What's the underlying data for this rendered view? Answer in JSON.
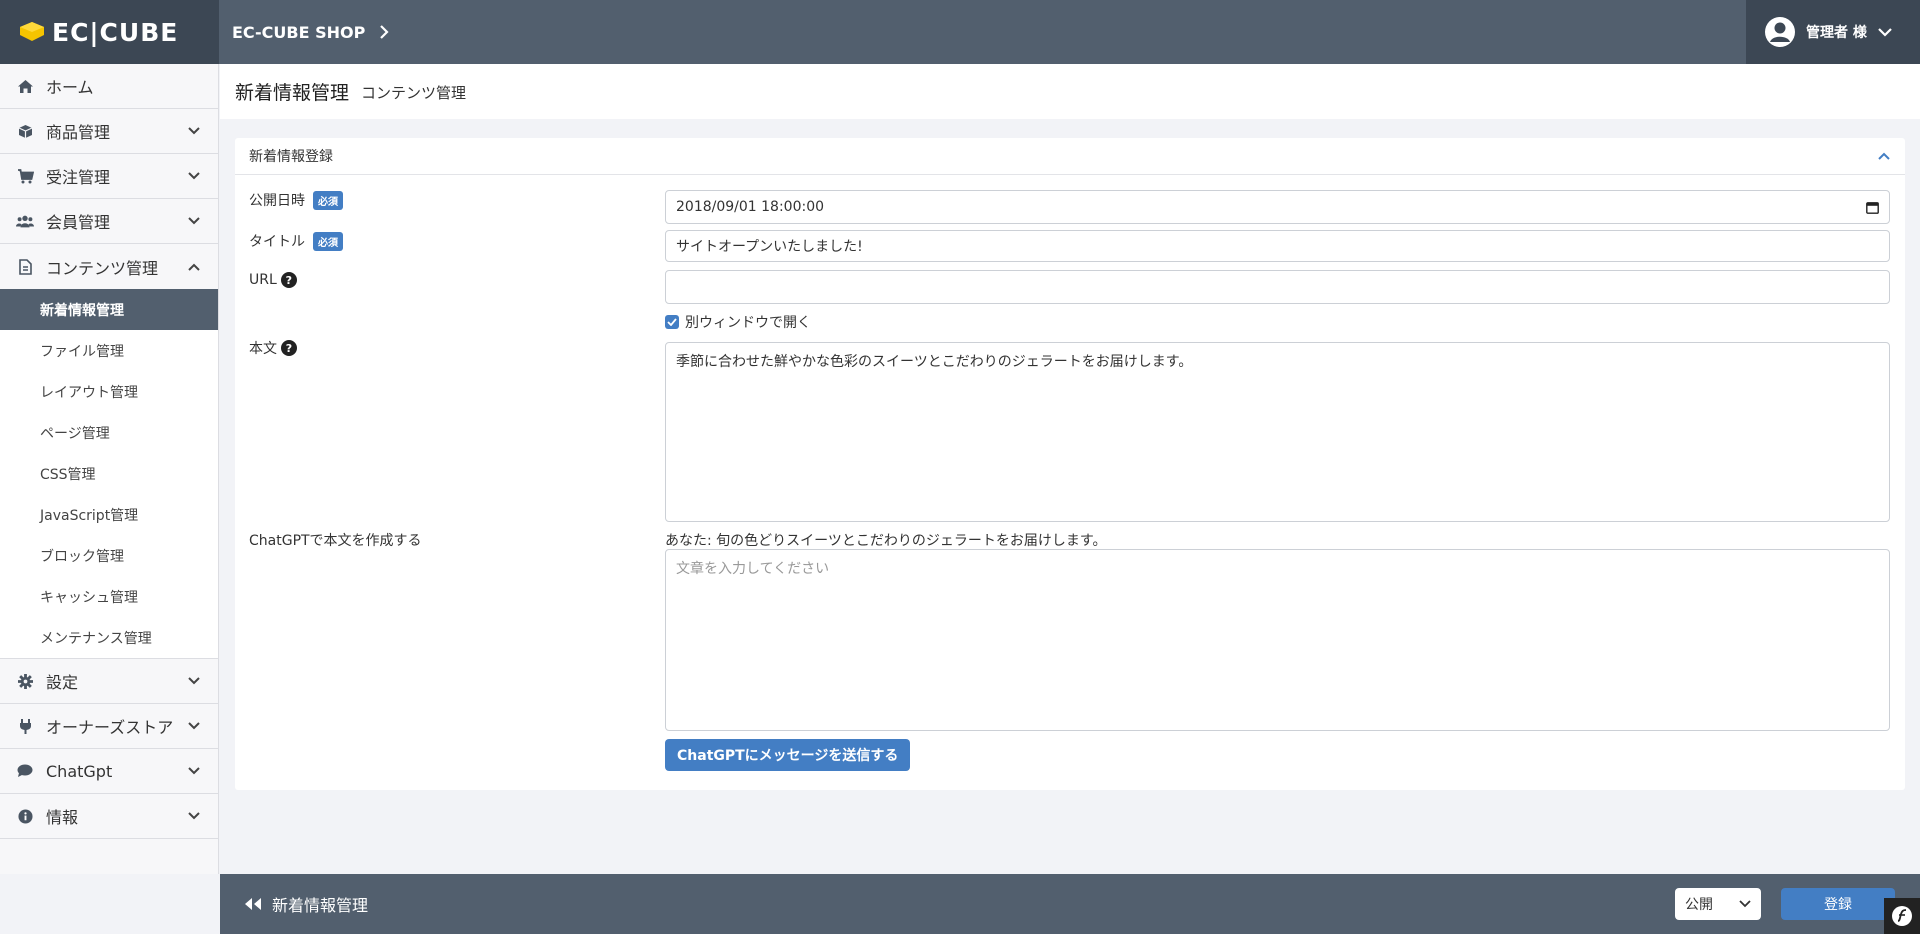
{
  "header": {
    "logo_text": "EC|CUBE",
    "shop_name": "EC-CUBE SHOP",
    "user_name": "管理者 様"
  },
  "sidebar": {
    "items": [
      {
        "label": "ホーム",
        "icon": "home-icon"
      },
      {
        "label": "商品管理",
        "icon": "box-icon"
      },
      {
        "label": "受注管理",
        "icon": "cart-icon"
      },
      {
        "label": "会員管理",
        "icon": "users-icon"
      },
      {
        "label": "コンテンツ管理",
        "icon": "file-icon"
      },
      {
        "label": "設定",
        "icon": "gear-icon"
      },
      {
        "label": "オーナーズストア",
        "icon": "plug-icon"
      },
      {
        "label": "ChatGpt",
        "icon": "comment-icon"
      },
      {
        "label": "情報",
        "icon": "info-icon"
      }
    ],
    "content_sub": [
      "新着情報管理",
      "ファイル管理",
      "レイアウト管理",
      "ページ管理",
      "CSS管理",
      "JavaScript管理",
      "ブロック管理",
      "キャッシュ管理",
      "メンテナンス管理"
    ]
  },
  "page": {
    "title": "新着情報管理",
    "subtitle": "コンテンツ管理"
  },
  "form": {
    "card_title": "新着情報登録",
    "required_badge": "必須",
    "publish_date_label": "公開日時",
    "publish_date_value": "2018/09/01 18:00:00",
    "title_label": "タイトル",
    "title_value": "サイトオープンいたしました!",
    "url_label": "URL",
    "url_value": "",
    "new_window_label": "別ウィンドウで開く",
    "body_label": "本文",
    "body_value": "季節に合わせた鮮やかな色彩のスイーツとこだわりのジェラートをお届けします。",
    "chatgpt_label": "ChatGPTで本文を作成する",
    "chatgpt_history": "あなた: 旬の色どりスイーツとこだわりのジェラートをお届けします。",
    "chatgpt_placeholder": "文章を入力してください",
    "chatgpt_send": "ChatGPTにメッセージを送信する"
  },
  "footer": {
    "back_label": "新着情報管理",
    "status_value": "公開",
    "submit_label": "登録"
  },
  "colors": {
    "header_bg": "#525f6e",
    "header_dark": "#3c4754",
    "accent": "#437ec4"
  }
}
